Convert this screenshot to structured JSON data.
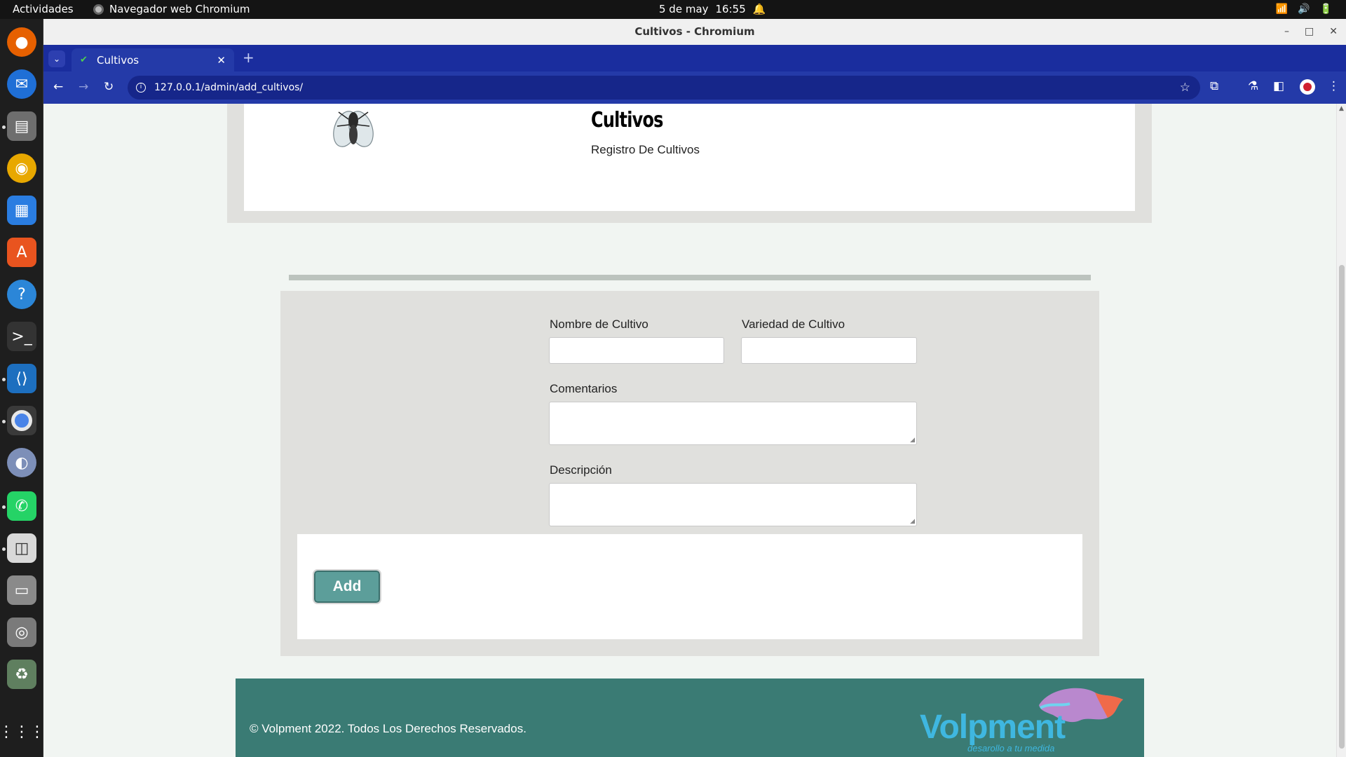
{
  "topbar": {
    "activities": "Actividades",
    "app_name": "Navegador web Chromium",
    "date": "5 de may",
    "time": "16:55"
  },
  "dock": {
    "apps": [
      "firefox-icon",
      "thunderbird-icon",
      "files-icon",
      "rhythmbox-icon",
      "writer-icon",
      "app-center-icon",
      "help-icon",
      "terminal-icon",
      "vscode-icon",
      "chromium-icon",
      "eagle-icon",
      "whatsapp-icon",
      "screenshot-icon",
      "drive-icon",
      "disc-icon",
      "trash-icon",
      "app-grid-icon"
    ]
  },
  "browser": {
    "window_title": "Cultivos - Chromium",
    "tab_title": "Cultivos",
    "url": "127.0.0.1/admin/add_cultivos/"
  },
  "page": {
    "title": "Cultivos",
    "subtitle": "Registro De Cultivos",
    "form": {
      "nombre_label": "Nombre de Cultivo",
      "nombre_value": "",
      "variedad_label": "Variedad de Cultivo",
      "variedad_value": "",
      "comentarios_label": "Comentarios",
      "comentarios_value": "",
      "descripcion_label": "Descripción",
      "descripcion_value": "",
      "submit_label": "Add"
    },
    "footer": {
      "copyright": "© Volpment 2022. Todos Los Derechos Reservados.",
      "brand_name": "Volpment",
      "brand_tagline": "desarollo a tu medida"
    }
  },
  "colors": {
    "tab_strip": "#1a2d9e",
    "toolbar": "#243aa8",
    "card_bg": "#e0e0dd",
    "button": "#5c9e9a",
    "footer": "#3a7b74",
    "brand": "#3fb7e0"
  }
}
